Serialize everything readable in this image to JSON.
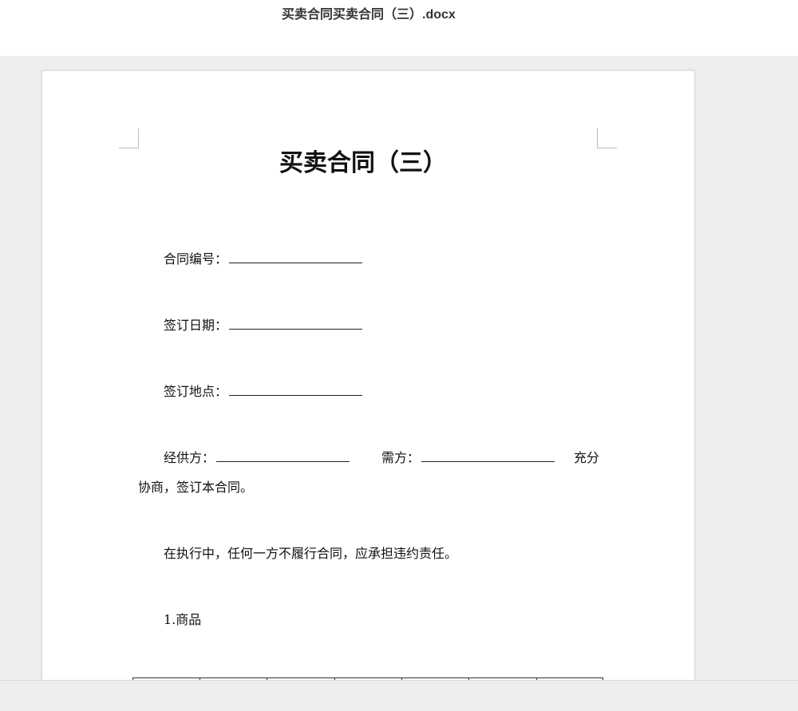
{
  "window": {
    "title": "买卖合同买卖合同（三）.docx"
  },
  "document": {
    "heading": "买卖合同（三）",
    "fields": {
      "contract_no": "合同编号：",
      "sign_date": "签订日期：",
      "sign_place": "签订地点："
    },
    "parties": {
      "supplier": "经供方：",
      "buyer": "需方：",
      "tail": "充分",
      "continuation": "协商，签订本合同。"
    },
    "clause": "在执行中，任何一方不履行合同，应承担违约责任。",
    "section_1": "1.商品"
  }
}
